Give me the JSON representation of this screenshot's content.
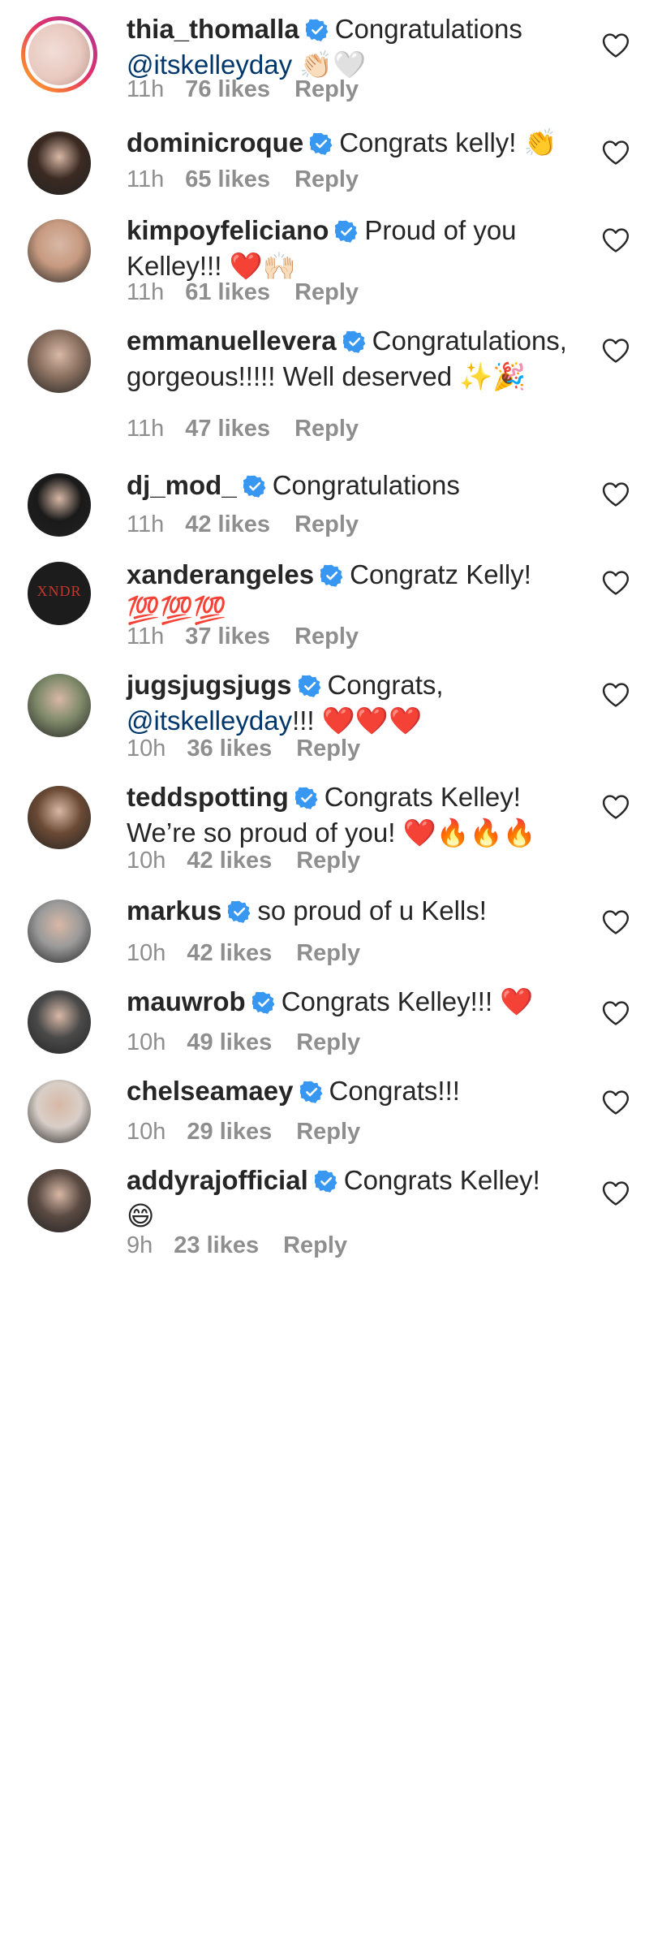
{
  "comments": [
    {
      "username": "thia_thomalla",
      "text": "Congratulations",
      "mention": "@itskelleyday",
      "emoji": "👏🏻🤍",
      "time": "11h",
      "likes": "76 likes",
      "reply": "Reply",
      "avatar_color": "#e8c9c0",
      "highlight": true
    },
    {
      "username": "dominicroque",
      "text": "Congrats kelly!",
      "mention": "",
      "emoji": "👏",
      "time": "11h",
      "likes": "65 likes",
      "reply": "Reply",
      "avatar_color": "#3b2a22"
    },
    {
      "username": "kimpoyfeliciano",
      "text": "Proud of you Kelley!!!",
      "mention": "",
      "emoji": "❤️🙌🏻",
      "time": "11h",
      "likes": "61 likes",
      "reply": "Reply",
      "avatar_color": "#c79a80"
    },
    {
      "username": "emmanuellevera",
      "text": "Congratulations, gorgeous!!!!! Well deserved",
      "mention": "",
      "emoji": "✨🎉",
      "time": "11h",
      "likes": "47 likes",
      "reply": "Reply",
      "avatar_color": "#8a7060"
    },
    {
      "username": "dj_mod_",
      "text": "Congratulations",
      "mention": "",
      "emoji": "",
      "time": "11h",
      "likes": "42 likes",
      "reply": "Reply",
      "avatar_color": "#1a1a1a"
    },
    {
      "username": "xanderangeles",
      "text": "Congratz Kelly!",
      "mention": "",
      "emoji": "💯💯💯",
      "time": "11h",
      "likes": "37 likes",
      "reply": "Reply",
      "avatar_color": "#1c1c1c",
      "avatar_text": "XNDR"
    },
    {
      "username": "jugsjugsjugs",
      "text": "Congrats,",
      "mention": "@itskelleyday",
      "suffix": "!!!",
      "emoji": "❤️❤️❤️",
      "time": "10h",
      "likes": "36 likes",
      "reply": "Reply",
      "avatar_color": "#7f8a6a"
    },
    {
      "username": "teddspotting",
      "text": "Congrats Kelley! We’re so proud of you!",
      "mention": "",
      "emoji": "❤️🔥🔥🔥",
      "time": "10h",
      "likes": "42 likes",
      "reply": "Reply",
      "avatar_color": "#6b4a35"
    },
    {
      "username": "markus",
      "text": "so proud of u Kells!",
      "mention": "",
      "emoji": "",
      "time": "10h",
      "likes": "42 likes",
      "reply": "Reply",
      "avatar_color": "#9a9a9a"
    },
    {
      "username": "mauwrob",
      "text": "Congrats Kelley!!!",
      "mention": "",
      "emoji": "❤️",
      "time": "10h",
      "likes": "49 likes",
      "reply": "Reply",
      "avatar_color": "#4a4a4a"
    },
    {
      "username": "chelseamaey",
      "text": "Congrats!!!",
      "mention": "",
      "emoji": "",
      "time": "10h",
      "likes": "29 likes",
      "reply": "Reply",
      "avatar_color": "#d9cfc8"
    },
    {
      "username": "addyrajofficial",
      "text": "Congrats Kelley!",
      "mention": "",
      "emoji": "😄",
      "time": "9h",
      "likes": "23 likes",
      "reply": "Reply",
      "avatar_color": "#5a4a42"
    }
  ],
  "colors": {
    "verified": "#3897f0",
    "mention": "#00376b",
    "meta": "#8e8e8e",
    "text": "#262626"
  },
  "icons": {
    "verified": "verified-badge-icon",
    "like": "heart-outline-icon"
  }
}
